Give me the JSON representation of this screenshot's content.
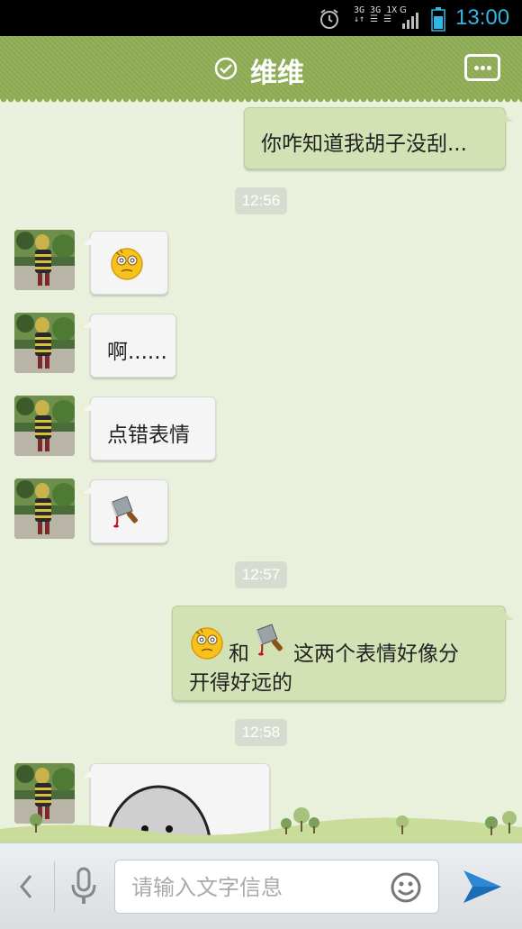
{
  "status_bar": {
    "net_top": "3G 3G 1X",
    "net_bottom": "↓↑ ☰ ☰",
    "net_g": "G",
    "time": "13:00",
    "icons": [
      "alarm-icon",
      "signal-icon",
      "battery-icon"
    ]
  },
  "header": {
    "title": "维维",
    "status_icon": "check-circle-icon",
    "menu_icon": "more-icon"
  },
  "messages": [
    {
      "side": "out",
      "text": "你咋知道我胡子没刮..."
    },
    {
      "type": "time",
      "text": "12:56"
    },
    {
      "side": "in",
      "emoji": "dizzy-face-emoji"
    },
    {
      "side": "in",
      "text": "啊......"
    },
    {
      "side": "in",
      "text": "点错表情"
    },
    {
      "side": "in",
      "emoji": "cleaver-emoji"
    },
    {
      "type": "time",
      "text": "12:57"
    },
    {
      "side": "out",
      "line1": "和",
      "line1b": "这两个表情好像分",
      "line2": "开得好远的",
      "emojis": [
        "dizzy-face-emoji",
        "cleaver-emoji"
      ]
    },
    {
      "type": "time",
      "text": "12:58"
    },
    {
      "side": "in",
      "image": "sticker-face"
    }
  ],
  "bottom_bar": {
    "input_placeholder": "请输入文字信息",
    "input_value": "",
    "icons": [
      "back-arrow-icon",
      "microphone-icon",
      "smiley-icon",
      "send-icon"
    ]
  },
  "colors": {
    "title_bar": "#8fad55",
    "chat_bg": "#e9f1dc",
    "out_bubble": "#d3e2b4",
    "in_bubble": "#f5f5f5",
    "time_accent": "#33b5e5",
    "send_blue": "#2e86d6"
  }
}
